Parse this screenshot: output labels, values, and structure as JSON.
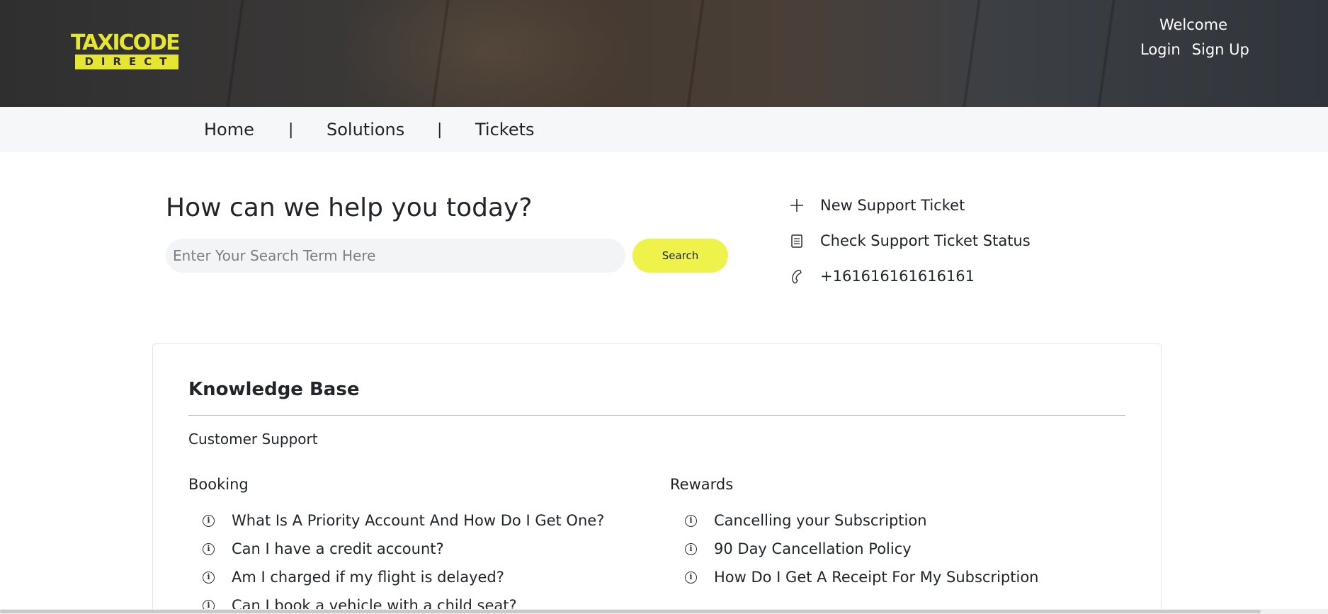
{
  "header": {
    "logo_top": "TAXICODE",
    "logo_bottom": "DIRECT",
    "welcome": "Welcome",
    "login_label": "Login",
    "signup_label": "Sign Up"
  },
  "nav": {
    "items": [
      "Home",
      "Solutions",
      "Tickets"
    ],
    "separator": "|"
  },
  "hero": {
    "title": "How can we help you today?",
    "search_placeholder": "Enter Your Search Term Here",
    "search_button": "Search"
  },
  "quick_links": [
    {
      "icon": "plus-icon",
      "label": "New Support Ticket"
    },
    {
      "icon": "document-icon",
      "label": "Check Support Ticket Status"
    },
    {
      "icon": "phone-icon",
      "label": "+161616161616161"
    }
  ],
  "knowledge_base": {
    "title": "Knowledge Base",
    "category": "Customer Support",
    "columns": [
      {
        "heading": "Booking",
        "articles": [
          "What Is A Priority Account And How Do I Get One?",
          "Can I have a credit account?",
          "Am I charged if my flight is delayed?",
          "Can I book a vehicle with a child seat?"
        ]
      },
      {
        "heading": "Rewards",
        "articles": [
          "Cancelling your Subscription",
          "90 Day Cancellation Policy",
          "How Do I Get A Receipt For My Subscription"
        ]
      }
    ]
  },
  "colors": {
    "brand_yellow": "#e6e632",
    "button_yellow": "#eef24a",
    "nav_bg": "#f6f7f9"
  }
}
